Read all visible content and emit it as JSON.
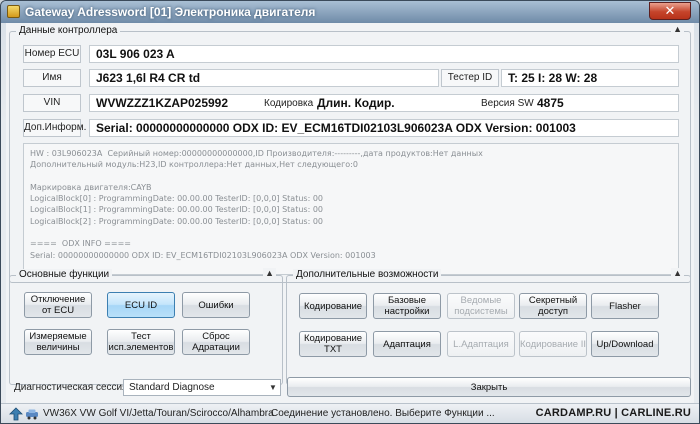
{
  "window": {
    "title": "Gateway Adressword [01] Электроника двигателя",
    "close_symbol": "✕"
  },
  "controller": {
    "legend": "Данные контроллера",
    "ecu_number_label": "Номер ECU",
    "ecu_number": "03L 906 023 A",
    "name_label": "Имя",
    "name": "J623  1,6l R4 CR td",
    "tester_label": "Тестер ID",
    "tester_value": "T: 25 I: 28 W: 28",
    "vin_label": "VIN",
    "vin": "WVWZZZ1KZAP025992",
    "coding_label": "Кодировка",
    "coding_value": "Длин. Кодир.",
    "sw_label": "Версия SW",
    "sw_value": "4875",
    "extra_label": "Доп.Информ.",
    "extra_value": "Serial: 00000000000000 ODX ID: EV_ECM16TDI02103L906023A ODX Version: 001003",
    "info_lines": [
      "HW : 03L906023A  Серийный номер:00000000000000,ID Производителя:---------,дата продуктов:Нет данных",
      "Дополнительный модуль:H23,ID контроллера:Нет данных,Нет следующего:0",
      "",
      "Маркировка двигателя:CAYB",
      "LogicalBlock[0] : ProgrammingDate: 00.00.00 TesterID: [0,0,0] Status: 00",
      "LogicalBlock[1] : ProgrammingDate: 00.00.00 TesterID: [0,0,0] Status: 00",
      "LogicalBlock[2] : ProgrammingDate: 00.00.00 TesterID: [0,0,0] Status: 00",
      "",
      "====  ODX INFO ====",
      "Serial: 00000000000000 ODX ID: EV_ECM16TDI02103L906023A ODX Version: 001003"
    ]
  },
  "main_functions": {
    "legend": "Основные функции",
    "buttons": {
      "disconnect": "Отключение от ECU",
      "ecu_id": "ECU ID",
      "errors": "Ошибки",
      "measured": "Измеряемые величины",
      "test": "Тест исп.элементов",
      "reset": "Сброс Адратации"
    }
  },
  "extra_functions": {
    "legend": "Дополнительные возможности",
    "buttons": {
      "coding": "Кодирование",
      "basic": "Базовые настройки",
      "subsystems": "Ведомые подсистемы",
      "secure": "Секретный доступ",
      "flasher": "Flasher",
      "coding_txt": "Кодирование TXT",
      "adaptation": "Адаптация",
      "l_adaptation": "L.Адаптация",
      "coding2": "Кодирование II",
      "updown": "Up/Download"
    }
  },
  "session": {
    "label": "Диагностическая сессия",
    "value": "Standard Diagnose"
  },
  "close_label": "Закрыть",
  "status": {
    "vehicle": "VW36X VW Golf VI/Jetta/Touran/Scirocco/Alhambra",
    "message": "Соединение установлено. Выберите Функции ...",
    "watermark": "CARDAMP.RU | CARLINE.RU"
  },
  "colors": {
    "accent_active": "#a6d6f7",
    "title_bar": "#6f8ba8",
    "close_red": "#c5442b"
  }
}
